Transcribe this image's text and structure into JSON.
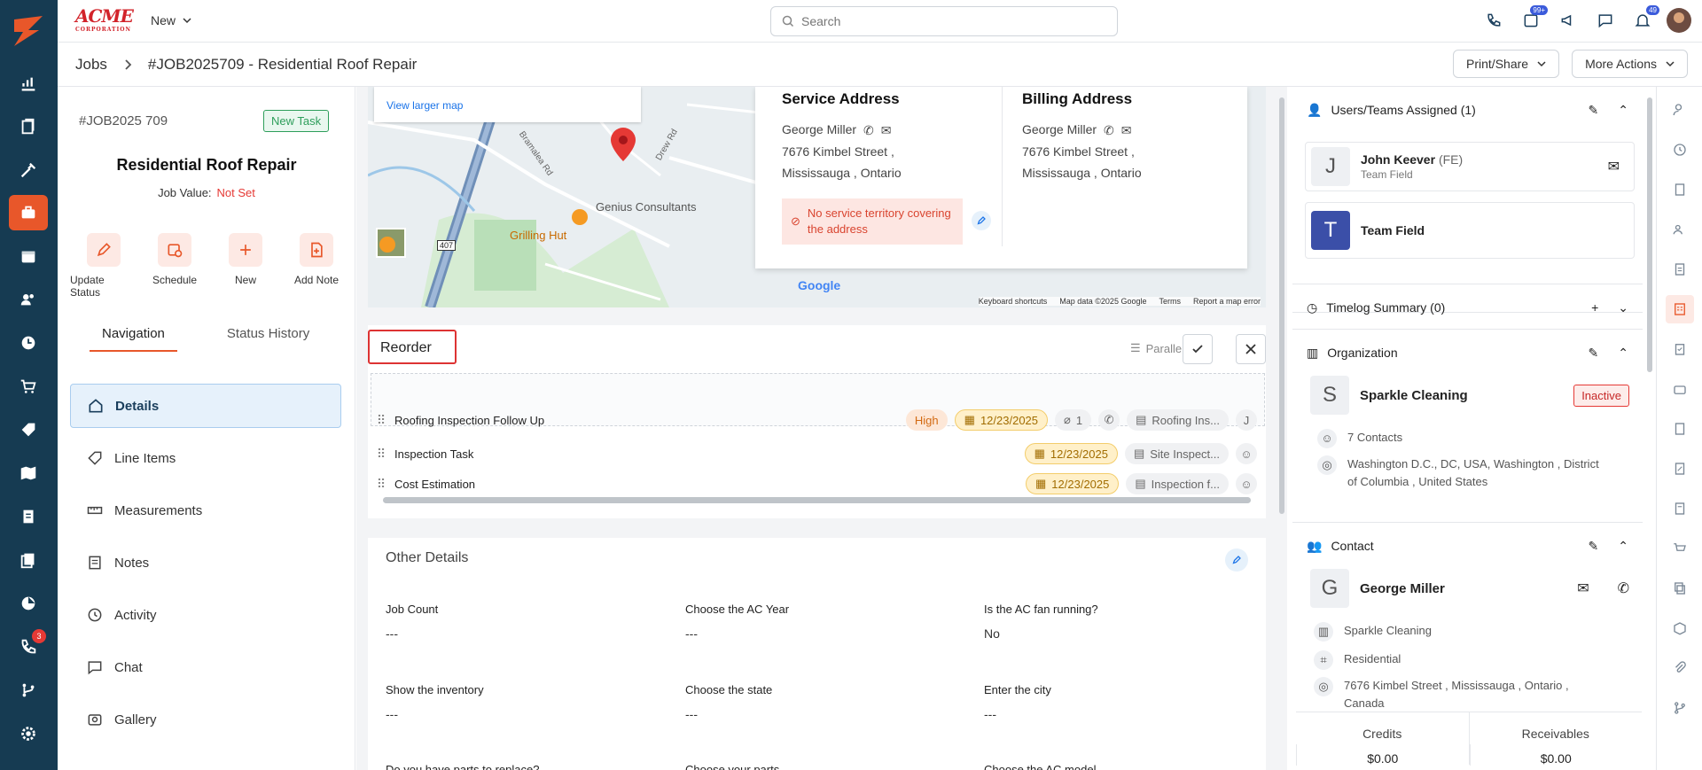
{
  "brand": {
    "name": "ACME",
    "sub": "CORPORATION"
  },
  "topbar": {
    "new_label": "New",
    "search_placeholder": "Search",
    "badges": {
      "tasks": "99+",
      "notifications": "49"
    }
  },
  "leftnav": {
    "phone_badge": "3"
  },
  "breadcrumb": {
    "root": "Jobs",
    "current": "#JOB2025709 - Residential Roof Repair"
  },
  "subbar": {
    "print_share": "Print/Share",
    "more_actions": "More Actions"
  },
  "job": {
    "number": "#JOB2025 709",
    "status_badge": "New Task",
    "title": "Residential Roof Repair",
    "value_label": "Job Value:",
    "value": "Not Set",
    "actions": [
      "Update Status",
      "Schedule",
      "New",
      "Add Note"
    ]
  },
  "left_tabs": [
    "Navigation",
    "Status History"
  ],
  "nav_items": [
    "Details",
    "Line Items",
    "Measurements",
    "Notes",
    "Activity",
    "Chat",
    "Gallery"
  ],
  "map": {
    "view_larger": "View larger map",
    "labels": [
      "Genius Consultants",
      "Grilling Hut",
      "Drew Rd",
      "Bramalea Rd",
      "407"
    ],
    "footer": [
      "Keyboard shortcuts",
      "Map data ©2025 Google",
      "Terms",
      "Report a map error"
    ],
    "google": "Google"
  },
  "service_address": {
    "title": "Service Address",
    "name": "George Miller",
    "line1": "7676 Kimbel Street ,",
    "line2": "Mississauga , Ontario",
    "warning": "No service territory covering the address"
  },
  "billing_address": {
    "title": "Billing Address",
    "name": "George Miller",
    "line1": "7676 Kimbel Street ,",
    "line2": "Mississauga , Ontario"
  },
  "reorder": {
    "title": "Reorder",
    "mode": "Parallel",
    "tasks": [
      {
        "name": "Roofing Inspection Follow Up",
        "priority": "High",
        "date": "12/23/2025",
        "attachments": "1",
        "form": "Roofing Ins...",
        "assignee": "J"
      },
      {
        "name": "Inspection Task",
        "date": "12/23/2025",
        "form": "Site Inspect..."
      },
      {
        "name": "Cost Estimation",
        "date": "12/23/2025",
        "form": "Inspection f..."
      }
    ]
  },
  "other_details": {
    "title": "Other Details",
    "fields": [
      {
        "label": "Job Count",
        "value": "---"
      },
      {
        "label": "Choose the AC Year",
        "value": "---"
      },
      {
        "label": "Is the AC fan running?",
        "value": "No"
      },
      {
        "label": "Show the inventory",
        "value": "---"
      },
      {
        "label": "Choose the state",
        "value": "---"
      },
      {
        "label": "Enter the city",
        "value": "---"
      },
      {
        "label": "Do you have parts to replace?",
        "value": ""
      },
      {
        "label": "Choose your parts",
        "value": ""
      },
      {
        "label": "Choose the AC model",
        "value": ""
      }
    ]
  },
  "right": {
    "users_title": "Users/Teams Assigned (1)",
    "user_name": "John Keever",
    "user_tag": "(FE)",
    "user_team": "Team Field",
    "team_name": "Team Field",
    "timelog_title": "Timelog Summary (0)",
    "org_title": "Organization",
    "org_name": "Sparkle Cleaning",
    "org_status": "Inactive",
    "org_contacts": "7 Contacts",
    "org_address": "Washington D.C., DC, USA, Washington , District of Columbia , United States",
    "contact_title": "Contact",
    "contact_name": "George Miller",
    "contact_company": "Sparkle Cleaning",
    "contact_type": "Residential",
    "contact_address": "7676 Kimbel Street , Mississauga , Ontario , Canada",
    "credits_label": "Credits",
    "credits_value": "$0.00",
    "receivables_label": "Receivables",
    "receivables_value": "$0.00"
  },
  "colors": {
    "accent": "#e8572a",
    "nav_bg": "#163b52",
    "active_nav": "#e6f1fb"
  }
}
